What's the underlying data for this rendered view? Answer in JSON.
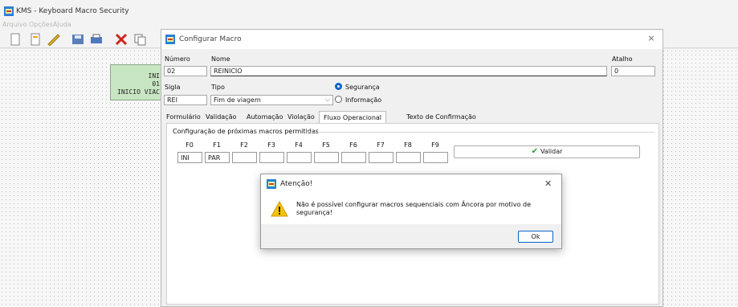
{
  "app": {
    "title": "KMS - Keyboard Macro Security"
  },
  "menu": [
    "Arquivo",
    "Opções",
    "Ajuda"
  ],
  "toolbar": [
    "new-file-icon",
    "new-doc-icon",
    "edit-icon",
    "save-icon",
    "print-icon",
    "delete-icon",
    "copy-icon"
  ],
  "canvas": {
    "node": {
      "line1": "INI",
      "line2": "01",
      "line3": "INICIO VIAC"
    }
  },
  "dialog": {
    "title": "Configurar Macro",
    "close": "×",
    "labels": {
      "numero": "Número",
      "nome": "Nome",
      "atalho": "Atalho",
      "sigla": "Sigla",
      "tipo": "Tipo"
    },
    "values": {
      "numero": "02",
      "nome": "REINICIO",
      "atalho": "0",
      "sigla": "REI",
      "tipo": "Fim de viagem"
    },
    "radios": {
      "seguranca": "Segurança",
      "informacao": "Informação"
    },
    "tabs": [
      "Formulário",
      "Validação",
      "Automação",
      "Violação",
      "Fluxo Operacional",
      "Texto de Confirmação"
    ],
    "group_title": "Configuração de próximas macros permitidas",
    "fkeys": [
      "F0",
      "F1",
      "F2",
      "F3",
      "F4",
      "F5",
      "F6",
      "F7",
      "F8",
      "F9"
    ],
    "fvalues": [
      "INI",
      "PAR",
      "",
      "",
      "",
      "",
      "",
      "",
      "",
      ""
    ],
    "validar": "Validar"
  },
  "alert": {
    "title": "Atenção!",
    "close": "✕",
    "message": "Não é possível configurar macros sequenciais com Âncora por motivo de segurança!",
    "ok": "Ok"
  },
  "colors": {
    "accent": "#0a64c8",
    "node_fill": "#c8e6c3",
    "warning": "#f5c400"
  }
}
